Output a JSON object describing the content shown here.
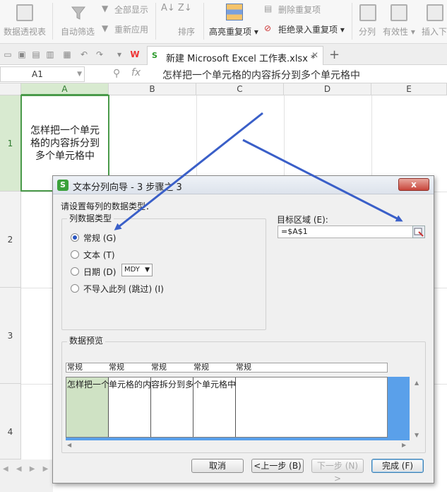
{
  "ribbon": {
    "pivot": "数据透视表",
    "autofilter": "自动筛选",
    "show_all": "全部显示",
    "reapply": "重新应用",
    "sort": "排序",
    "highlight_dup": "高亮重复项",
    "delete_dup": "删除重复项",
    "reject_dup": "拒绝录入重复项",
    "split": "分列",
    "validity": "有效性",
    "insert_dropdown": "插入下"
  },
  "tabbar": {
    "doc_title": "新建 Microsoft Excel 工作表.xlsx *"
  },
  "formula_bar": {
    "cell_ref": "A1",
    "fx": "fx",
    "formula": "怎样把一个单元格的内容拆分到多个单元格中"
  },
  "grid": {
    "columns": [
      "A",
      "B",
      "C",
      "D",
      "E"
    ],
    "rows": [
      "1",
      "2",
      "3",
      "4"
    ],
    "a1_text": "怎样把一个单元格的内容拆分到多个单元格中"
  },
  "dialog": {
    "title": "文本分列向导 - 3 步骤之 3",
    "close": "x",
    "instruction": "请设置每列的数据类型：",
    "group_type_title": "列数据类型",
    "options": [
      {
        "label": "常规 (G)",
        "selected": true
      },
      {
        "label": "文本 (T)",
        "selected": false
      },
      {
        "label": "日期 (D)",
        "selected": false
      },
      {
        "label": "不导入此列 (跳过) (I)",
        "selected": false
      }
    ],
    "date_format": "MDY",
    "target_label": "目标区域 (E):",
    "target_value": "=$A$1",
    "preview_title": "数据预览",
    "preview_headers": [
      "常规",
      "常规",
      "常规",
      "常规",
      "常规"
    ],
    "preview_cells": [
      "怎样把一个",
      "单元格的内",
      "容拆分到多",
      "个单元格中",
      ""
    ],
    "buttons": {
      "cancel": "取消",
      "back": "<上一步 (B)",
      "next": "下一步 (N) >",
      "finish": "完成 (F)"
    }
  },
  "colors": {
    "selection_green": "#4a9a4a",
    "dialog_bg": "#f0f0f0",
    "annotation_arrow": "#3a5fc8",
    "preview_highlight": "#5aa0ea"
  }
}
